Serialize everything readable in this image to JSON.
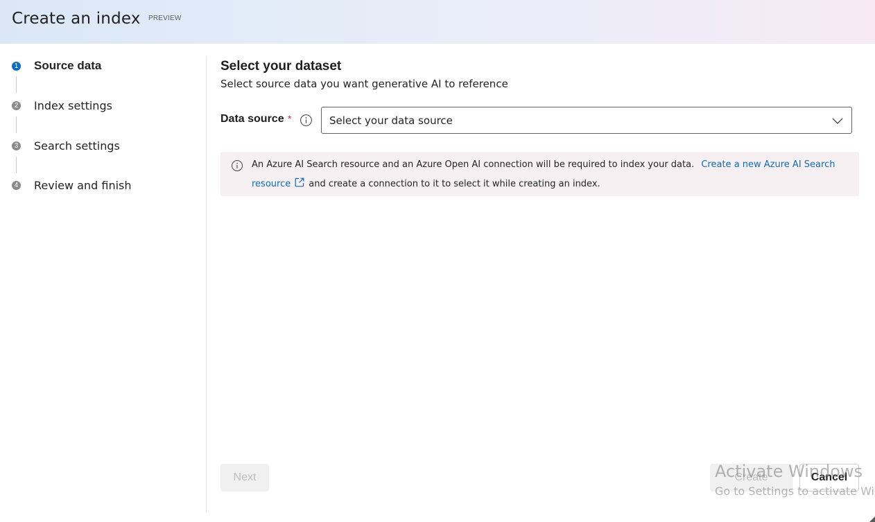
{
  "header": {
    "title": "Create an index",
    "badge": "PREVIEW"
  },
  "stepper": {
    "steps": [
      {
        "number": "1",
        "label": "Source data",
        "active": true
      },
      {
        "number": "2",
        "label": "Index settings",
        "active": false
      },
      {
        "number": "3",
        "label": "Search settings",
        "active": false
      },
      {
        "number": "4",
        "label": "Review and finish",
        "active": false
      }
    ]
  },
  "main": {
    "title": "Select your dataset",
    "subtitle": "Select source data you want generative AI to reference",
    "data_source": {
      "label": "Data source",
      "required_mark": "*",
      "placeholder": "Select your data source"
    },
    "info_bar": {
      "text_part1": "An Azure AI Search resource and an Azure Open AI connection will be required to index your data.",
      "link_part1": "Create a new Azure AI Search",
      "link_part2": "resource",
      "text_part2": "and create a connection to it to select it while creating an index."
    }
  },
  "footer": {
    "next_label": "Next",
    "create_label": "Create",
    "cancel_label": "Cancel"
  },
  "watermark": {
    "line1": "Activate Windows",
    "line2": "Go to Settings to activate Windows."
  },
  "colors": {
    "accent": "#0f6cbd",
    "required": "#c4314b",
    "info_bar_bg": "#f6f0f2"
  }
}
